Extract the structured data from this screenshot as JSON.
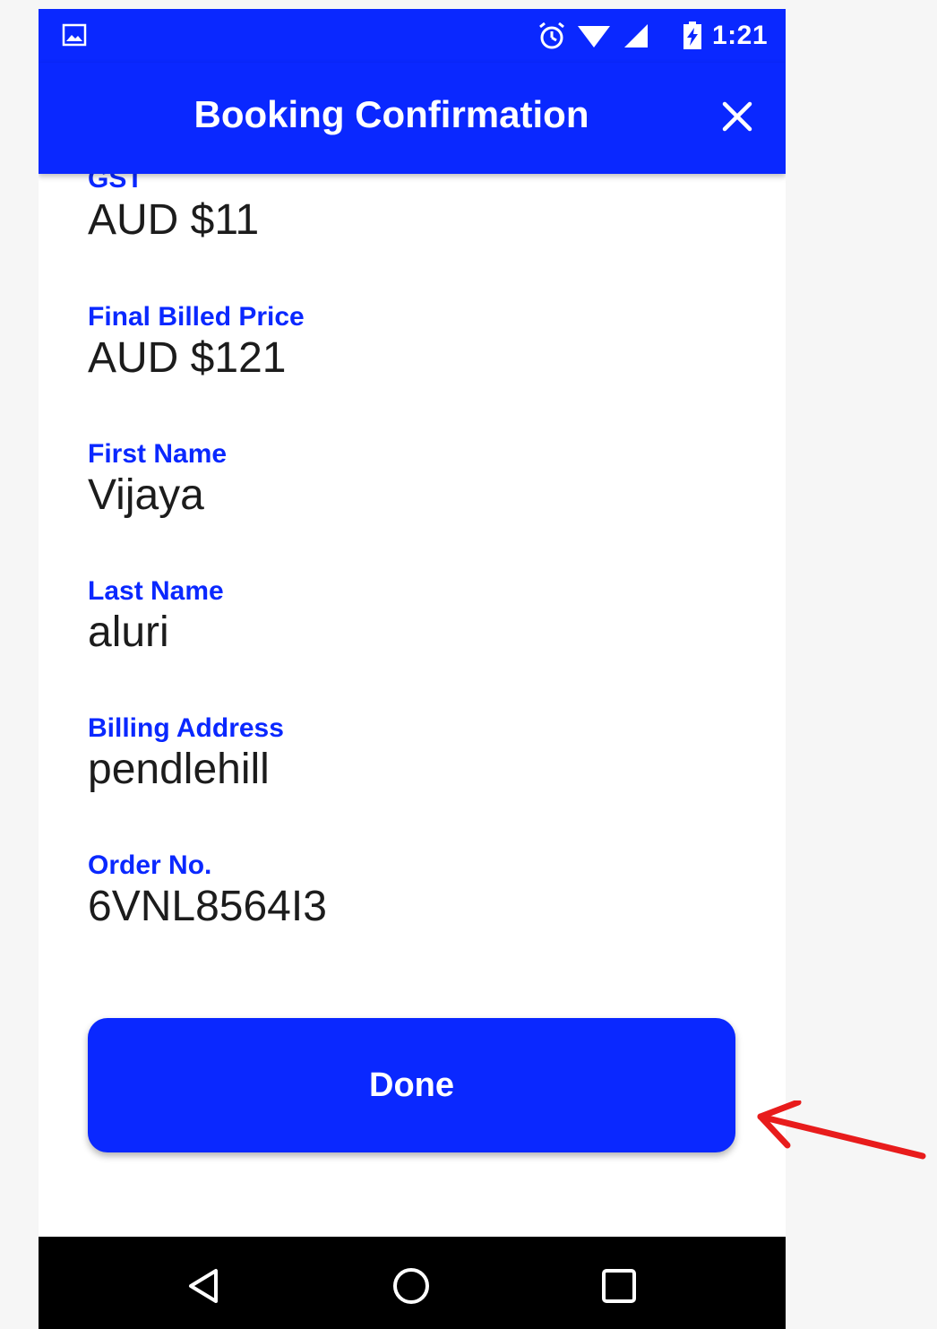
{
  "status_bar": {
    "time": "1:21",
    "icons": [
      "image-icon",
      "alarm-icon",
      "wifi-icon",
      "signal-icon",
      "battery-charging-icon"
    ]
  },
  "app_bar": {
    "title": "Booking Confirmation",
    "close_icon": "close-icon"
  },
  "fields": [
    {
      "label": "GST",
      "value": "AUD $11"
    },
    {
      "label": "Final Billed Price",
      "value": "AUD $121"
    },
    {
      "label": "First Name",
      "value": "Vijaya"
    },
    {
      "label": "Last Name",
      "value": "aluri"
    },
    {
      "label": "Billing Address",
      "value": "pendlehill"
    },
    {
      "label": "Order No.",
      "value": "6VNL8564I3"
    }
  ],
  "done_button": {
    "label": "Done"
  },
  "nav_bar": {
    "icons": [
      "back-icon",
      "home-icon",
      "recents-icon"
    ]
  },
  "colors": {
    "accent": "#0a28ff",
    "annotation_arrow": "#e81c1c"
  }
}
